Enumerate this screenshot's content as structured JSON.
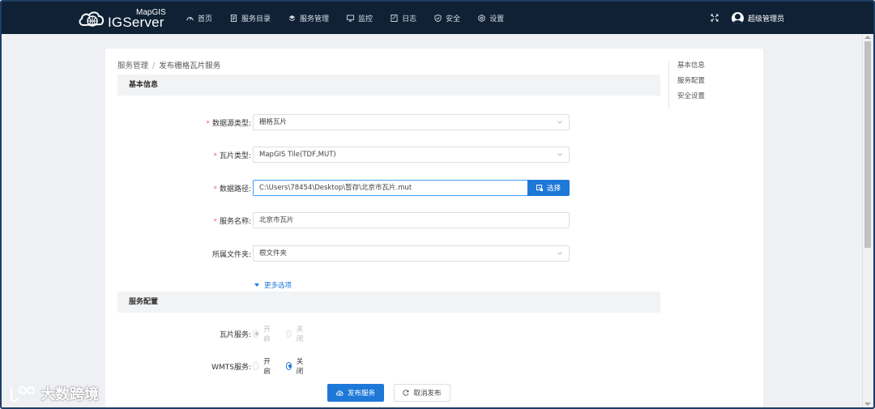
{
  "brand": {
    "top": "MapGIS",
    "main": "IGServer"
  },
  "nav": [
    {
      "label": "首页",
      "icon": "dashboard-icon"
    },
    {
      "label": "服务目录",
      "icon": "catalog-icon"
    },
    {
      "label": "服务管理",
      "icon": "layers-icon"
    },
    {
      "label": "监控",
      "icon": "monitor-icon"
    },
    {
      "label": "日志",
      "icon": "log-icon"
    },
    {
      "label": "安全",
      "icon": "shield-icon"
    },
    {
      "label": "设置",
      "icon": "gear-icon"
    }
  ],
  "user": {
    "name": "超级管理员"
  },
  "breadcrumb": {
    "parent": "服务管理",
    "current": "发布栅格瓦片服务"
  },
  "sections": {
    "basic": "基本信息",
    "config": "服务配置"
  },
  "form": {
    "source_type": {
      "label": "数据源类型:",
      "value": "栅格瓦片"
    },
    "tile_type": {
      "label": "瓦片类型:",
      "value": "MapGIS Tile(TDF,MUT)"
    },
    "data_path": {
      "label": "数据路径:",
      "value": "C:\\Users\\78454\\Desktop\\暂存\\北京市瓦片.mut",
      "button": "选择"
    },
    "service_name": {
      "label": "服务名称:",
      "value": "北京市瓦片"
    },
    "folder": {
      "label": "所属文件夹:",
      "value": "根文件夹"
    },
    "more": "更多选项"
  },
  "config": {
    "tile_service": {
      "label": "瓦片服务:",
      "on": "开启",
      "off": "关闭"
    },
    "wmts_service": {
      "label": "WMTS服务:",
      "on": "开启",
      "off": "关闭"
    }
  },
  "footer": {
    "publish": "发布服务",
    "cancel": "取消发布"
  },
  "side_nav": [
    "基本信息",
    "服务配置",
    "安全设置"
  ],
  "watermark": "大数跨境",
  "colors": {
    "topbar": "#102135",
    "primary": "#1e78d8",
    "required": "#f56c6c"
  }
}
